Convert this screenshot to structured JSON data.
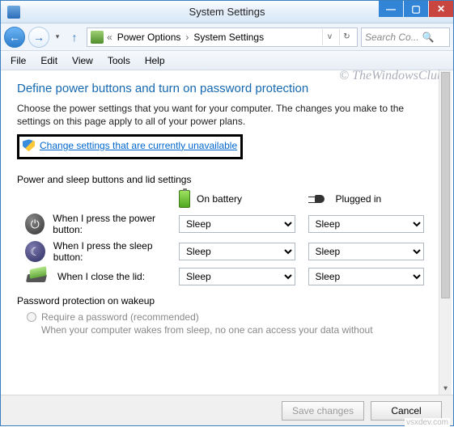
{
  "window": {
    "title": "System Settings"
  },
  "nav": {
    "breadcrumb": [
      "Power Options",
      "System Settings"
    ],
    "separator_pre": "«",
    "search_placeholder": "Search Co..."
  },
  "menu": {
    "items": [
      "File",
      "Edit",
      "View",
      "Tools",
      "Help"
    ]
  },
  "watermark": "© TheWindowsClub",
  "heading": "Define power buttons and turn on password protection",
  "description": "Choose the power settings that you want for your computer. The changes you make to the settings on this page apply to all of your power plans.",
  "change_link": "Change settings that are currently unavailable",
  "section1": {
    "title": "Power and sleep buttons and lid settings",
    "col_battery": "On battery",
    "col_plugged": "Plugged in",
    "rows": [
      {
        "label": "When I press the power button:",
        "battery": "Sleep",
        "plugged": "Sleep"
      },
      {
        "label": "When I press the sleep button:",
        "battery": "Sleep",
        "plugged": "Sleep"
      },
      {
        "label": "When I close the lid:",
        "battery": "Sleep",
        "plugged": "Sleep"
      }
    ]
  },
  "section2": {
    "title": "Password protection on wakeup",
    "radio1": "Require a password (recommended)",
    "note": "When your computer wakes from sleep, no one can access your data without"
  },
  "footer": {
    "save": "Save changes",
    "cancel": "Cancel"
  },
  "srctag": "vsxdev.com"
}
